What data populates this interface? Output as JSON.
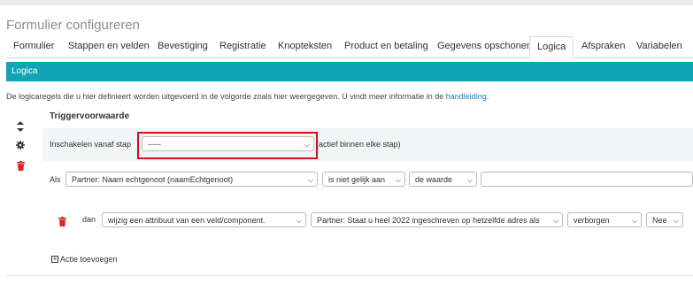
{
  "page": {
    "title": "Formulier configureren"
  },
  "tabs": [
    {
      "label": "Formulier"
    },
    {
      "label": "Stappen en velden"
    },
    {
      "label": "Bevestiging"
    },
    {
      "label": "Registratie"
    },
    {
      "label": "Knopteksten"
    },
    {
      "label": "Product en betaling"
    },
    {
      "label": "Gegevens opschonen"
    },
    {
      "label": "Logica"
    },
    {
      "label": "Afspraken"
    },
    {
      "label": "Variabelen"
    }
  ],
  "active_tab": "Logica",
  "section": {
    "title": "Logica"
  },
  "info": {
    "text": "De logicaregels die u hier definieert worden uitgevoerd in de volgorde zoals hier weergegeven. U vindt meer informatie in de ",
    "link": "handleiding",
    "suffix": "."
  },
  "trigger": {
    "title": "Triggervoorwaarde",
    "step_label": "Inschakelen vanaf stap",
    "step_value": "-----",
    "step_note": "(actief binnen elke stap)",
    "als_label": "Als",
    "field_value": "Partner: Naam echtgenoot (naamEchtgenoot)",
    "operator_value": "is niet gelijk aan",
    "compare_value": "de waarde",
    "value_input": ""
  },
  "action": {
    "dan_label": "dan",
    "action_value": "wijzig een attribuut van een veld/component.",
    "component_value": "Partner: Staat u heel 2022 ingeschreven op hetzelfde adres als",
    "attribute_value": "verborgen",
    "bool_value": "Nee"
  },
  "add_action": {
    "label": "Actie toevoegen"
  },
  "colors": {
    "accent": "#12a4b5",
    "danger": "#d9262a",
    "highlight": "#d0101a",
    "link": "#1e7fb8"
  },
  "icons": [
    "sort-icon",
    "gear-icon",
    "trash-icon",
    "chevron-down-icon",
    "plus-box-icon"
  ]
}
